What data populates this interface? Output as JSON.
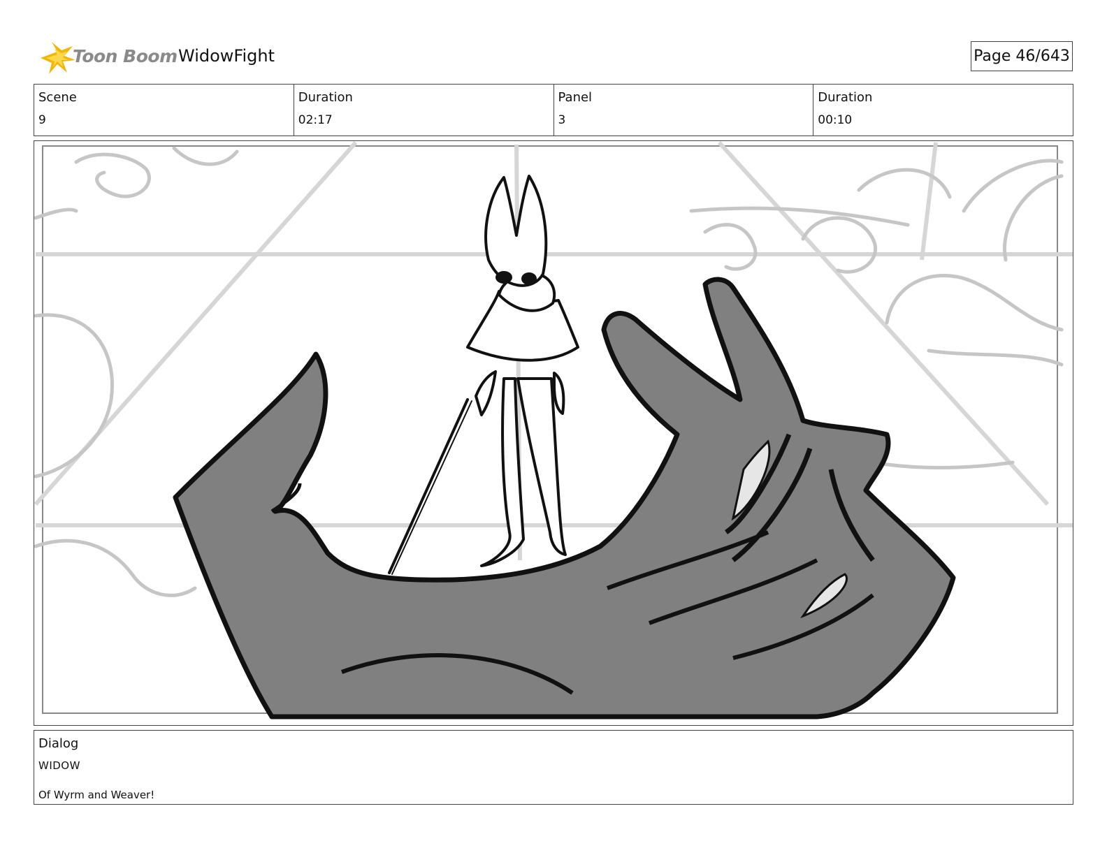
{
  "header": {
    "logo_text": "Toon Boom",
    "project_title": "WidowFight",
    "page_label": "Page",
    "page_number": "46/643"
  },
  "info": {
    "scene_label": "Scene",
    "scene_value": "9",
    "scene_duration_label": "Duration",
    "scene_duration_value": "02:17",
    "panel_label": "Panel",
    "panel_value": "3",
    "panel_duration_label": "Duration",
    "panel_duration_value": "00:10"
  },
  "dialog": {
    "label": "Dialog",
    "character": "WIDOW",
    "line": "Of Wyrm and Weaver!"
  },
  "colors": {
    "logo_accent": "#f2b705",
    "sketch_fill": "#808080",
    "background_lines": "#c8c8c8"
  }
}
